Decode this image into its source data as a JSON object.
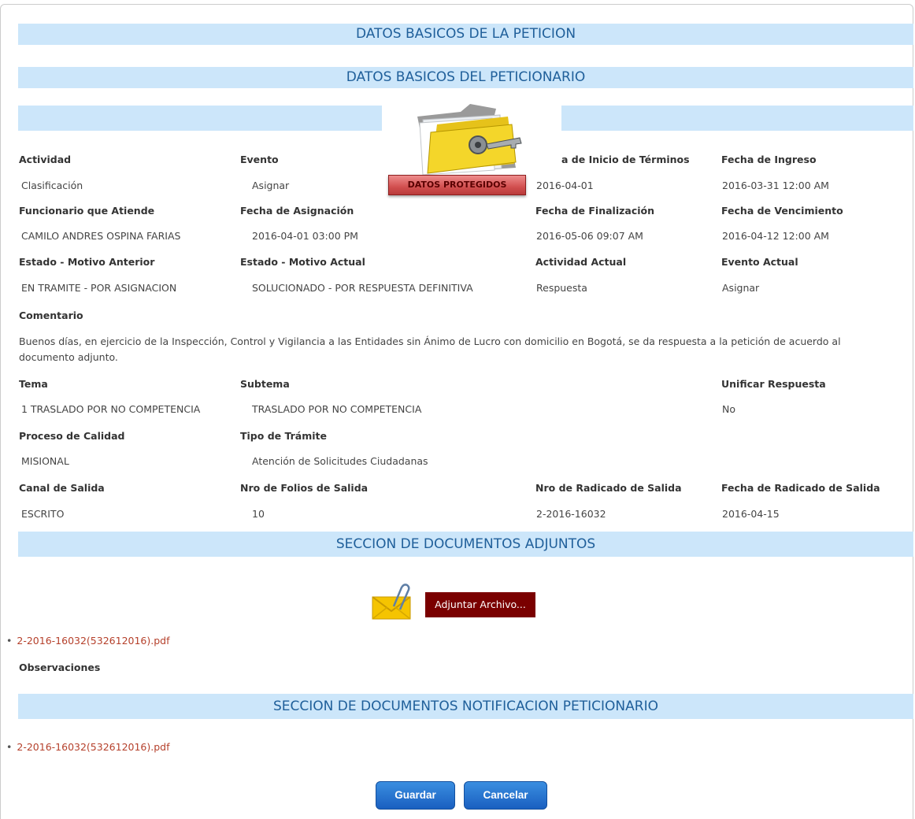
{
  "bands": {
    "peticion": "DATOS BASICOS DE LA PETICION",
    "peticionario": "DATOS BASICOS DEL PETICIONARIO",
    "adjuntos": "SECCION DE DOCUMENTOS ADJUNTOS",
    "notificacion": "SECCION DE DOCUMENTOS NOTIFICACION PETICIONARIO"
  },
  "protected_label": "DATOS PROTEGIDOS",
  "fields": {
    "actividad": {
      "label": "Actividad",
      "value": "Clasificación"
    },
    "evento": {
      "label": "Evento",
      "value": "Asignar"
    },
    "inicio_terminos": {
      "label": "a de Inicio de Términos",
      "value": "2016-04-01"
    },
    "fecha_ingreso": {
      "label": "Fecha de Ingreso",
      "value": "2016-03-31 12:00 AM"
    },
    "funcionario": {
      "label": "Funcionario que Atiende",
      "value": "CAMILO ANDRES  OSPINA FARIAS"
    },
    "fecha_asignacion": {
      "label": "Fecha de Asignación",
      "value": "2016-04-01 03:00 PM"
    },
    "fecha_finalizacion": {
      "label": "Fecha de Finalización",
      "value": "2016-05-06 09:07 AM"
    },
    "fecha_vencimiento": {
      "label": "Fecha de Vencimiento",
      "value": "2016-04-12 12:00 AM"
    },
    "estado_anterior": {
      "label": "Estado - Motivo Anterior",
      "value": "EN TRAMITE - POR ASIGNACION"
    },
    "estado_actual": {
      "label": "Estado - Motivo Actual",
      "value": "SOLUCIONADO - POR RESPUESTA DEFINITIVA"
    },
    "actividad_actual": {
      "label": "Actividad Actual",
      "value": "Respuesta"
    },
    "evento_actual": {
      "label": "Evento Actual",
      "value": "Asignar"
    },
    "comentario": {
      "label": "Comentario",
      "value": "Buenos días, en ejercicio de la Inspección, Control y Vigilancia a las Entidades sin Ánimo de Lucro con domicilio en Bogotá, se da respuesta a la petición de acuerdo al documento adjunto."
    },
    "tema": {
      "label": "Tema",
      "value": "1 TRASLADO POR NO COMPETENCIA"
    },
    "subtema": {
      "label": "Subtema",
      "value": "TRASLADO POR NO COMPETENCIA"
    },
    "unificar": {
      "label": "Unificar Respuesta",
      "value": "No"
    },
    "proceso": {
      "label": "Proceso de Calidad",
      "value": "MISIONAL"
    },
    "tipo_tramite": {
      "label": "Tipo de Trámite",
      "value": "Atención de Solicitudes Ciudadanas"
    },
    "canal_salida": {
      "label": "Canal de Salida",
      "value": "ESCRITO"
    },
    "folios_salida": {
      "label": "Nro de Folios de Salida",
      "value": "10"
    },
    "radicado_salida": {
      "label": "Nro de Radicado de Salida",
      "value": "2-2016-16032"
    },
    "fecha_radicado_salida": {
      "label": "Fecha de Radicado de Salida",
      "value": "2016-04-15"
    }
  },
  "attach_button": "Adjuntar Archivo...",
  "attachments": [
    "2-2016-16032(532612016).pdf"
  ],
  "observaciones_label": "Observaciones",
  "notification_docs": [
    "2-2016-16032(532612016).pdf"
  ],
  "buttons": {
    "save": "Guardar",
    "cancel": "Cancelar"
  },
  "icons": {
    "protected": "folder-key-icon",
    "attach": "envelope-clip-icon"
  }
}
